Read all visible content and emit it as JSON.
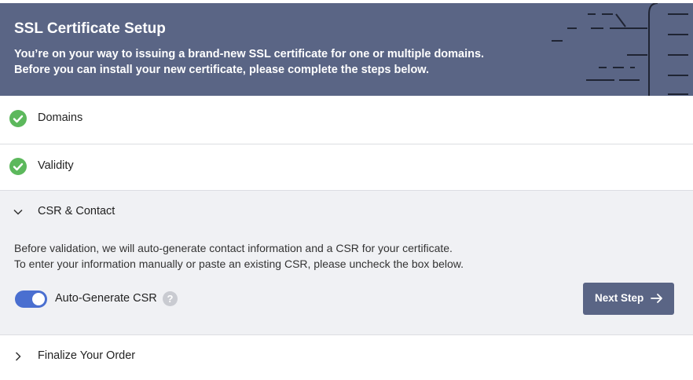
{
  "header": {
    "title": "SSL Certificate Setup",
    "line1": "You’re on your way to issuing a brand-new SSL certificate for one or multiple domains.",
    "line2": "Before you can install your new certificate, please complete the steps below."
  },
  "steps": [
    {
      "label": "Domains",
      "status": "complete",
      "icon": "check-circle-icon"
    },
    {
      "label": "Validity",
      "status": "complete",
      "icon": "check-circle-icon"
    },
    {
      "label": "CSR & Contact",
      "status": "expanded",
      "icon": "chevron-down-icon"
    },
    {
      "label": "Finalize Your Order",
      "status": "collapsed",
      "icon": "chevron-right-icon"
    }
  ],
  "csr": {
    "line1": "Before validation, we will auto-generate contact information and a CSR for your certificate.",
    "line2": "To enter your information manually or paste an existing CSR, please uncheck the box below.",
    "toggle_label": "Auto-Generate CSR",
    "toggle_on": true,
    "help_glyph": "?",
    "next_label": "Next Step"
  },
  "colors": {
    "header_bg": "#5a6585",
    "check_green": "#5cb85c",
    "toggle_blue": "#4a6fd0",
    "expanded_bg": "#f0f1f4"
  }
}
